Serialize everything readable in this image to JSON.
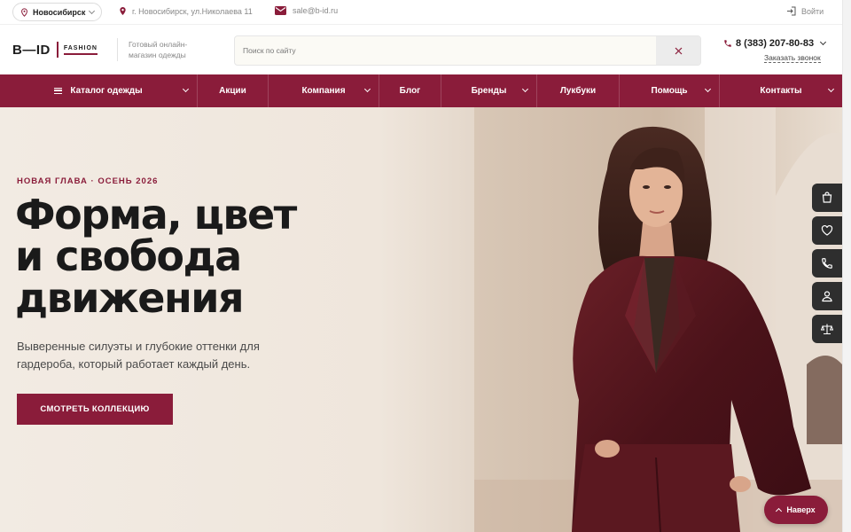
{
  "topbar": {
    "city": "Новосибирск",
    "address": "г. Новосибирск, ул.Николаева 11",
    "email": "sale@b-id.ru",
    "login": "Войти"
  },
  "header": {
    "logo_main": "B—ID",
    "logo_sub": "FASHION",
    "tagline": "Готовый онлайн-магазин одежды",
    "search_placeholder": "Поиск по сайту",
    "phone": "8 (383) 207-80-83",
    "callback": "Заказать звонок"
  },
  "nav": [
    {
      "label": "Каталог одежды",
      "has_menu": true
    },
    {
      "label": "Акции",
      "has_menu": false
    },
    {
      "label": "Компания",
      "has_menu": true
    },
    {
      "label": "Блог",
      "has_menu": false
    },
    {
      "label": "Бренды",
      "has_menu": true
    },
    {
      "label": "Лукбуки",
      "has_menu": false
    },
    {
      "label": "Помощь",
      "has_menu": true
    },
    {
      "label": "Контакты",
      "has_menu": true
    }
  ],
  "hero": {
    "eyebrow": "НОВАЯ ГЛАВА · ОСЕНЬ 2026",
    "headline_1": "Форма, цвет",
    "headline_2": "и свобода",
    "headline_3": "движения",
    "subtext": "Выверенные силуэты и глубокие оттенки для гардероба, который работает каждый день.",
    "cta": "СМОТРЕТЬ КОЛЛЕКЦИЮ"
  },
  "rail_icons": [
    "cart-icon",
    "heart-icon",
    "phone-icon",
    "user-icon",
    "compare-icon"
  ],
  "totop": "Наверх",
  "colors": {
    "brand": "#8a1c3a",
    "dark": "#1d1d1d",
    "rail": "#2e2e2e"
  }
}
